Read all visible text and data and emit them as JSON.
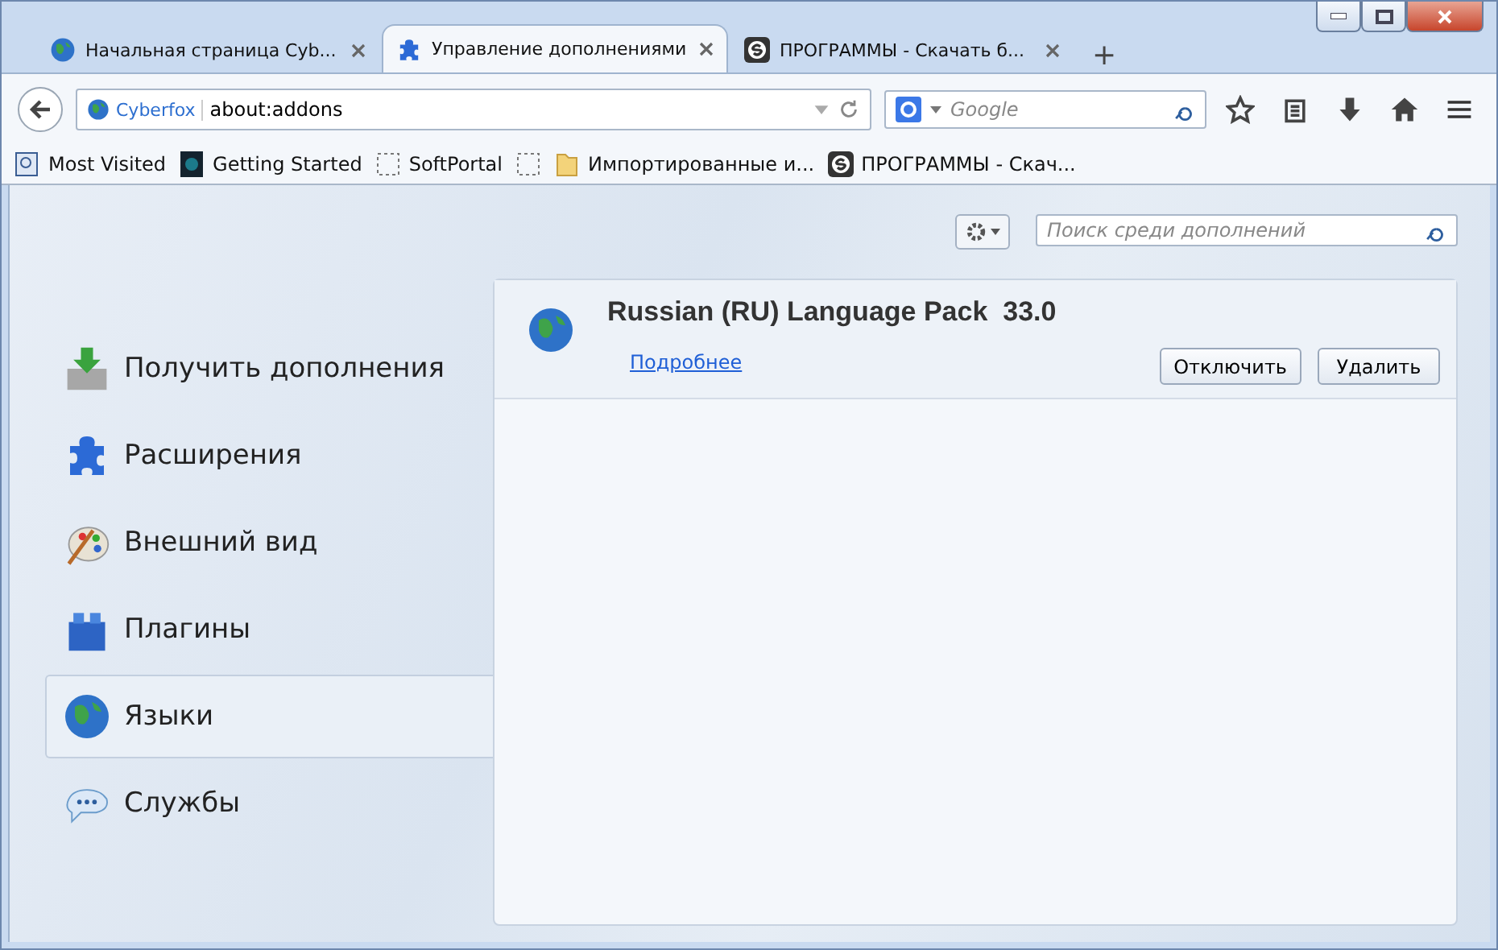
{
  "tabs": [
    {
      "label": "Начальная страница Cyb...",
      "kind": "globe",
      "selected": false
    },
    {
      "label": "Управление дополнениями",
      "kind": "puzzle",
      "selected": true
    },
    {
      "label": "ПРОГРАММЫ - Скачать б...",
      "kind": "s",
      "selected": false
    }
  ],
  "new_tab": "+",
  "url_bar": {
    "identity": "Cyberfox",
    "value": "about:addons"
  },
  "search_bar": {
    "placeholder": "Google"
  },
  "bookmarks": [
    {
      "label": "Most Visited",
      "kind": "page"
    },
    {
      "label": "Getting Started",
      "kind": "dark"
    },
    {
      "label": "SoftPortal",
      "kind": "blank"
    },
    {
      "kind": "blank"
    },
    {
      "label": "Импортированные и...",
      "kind": "folder"
    },
    {
      "label": "ПРОГРАММЫ - Скач...",
      "kind": "s"
    }
  ],
  "addon_search": {
    "placeholder": "Поиск среди дополнений"
  },
  "categories": [
    {
      "label": "Получить дополнения",
      "kind": "download",
      "selected": false
    },
    {
      "label": "Расширения",
      "kind": "puzzle",
      "selected": false
    },
    {
      "label": "Внешний вид",
      "kind": "palette",
      "selected": false
    },
    {
      "label": "Плагины",
      "kind": "brick",
      "selected": false
    },
    {
      "label": "Языки",
      "kind": "globe",
      "selected": true
    },
    {
      "label": "Службы",
      "kind": "chat",
      "selected": false
    }
  ],
  "addons": [
    {
      "name": "Russian (RU) Language Pack",
      "version": "33.0",
      "more_link": "Подробнее",
      "buttons": [
        "Отключить",
        "Удалить"
      ]
    }
  ]
}
